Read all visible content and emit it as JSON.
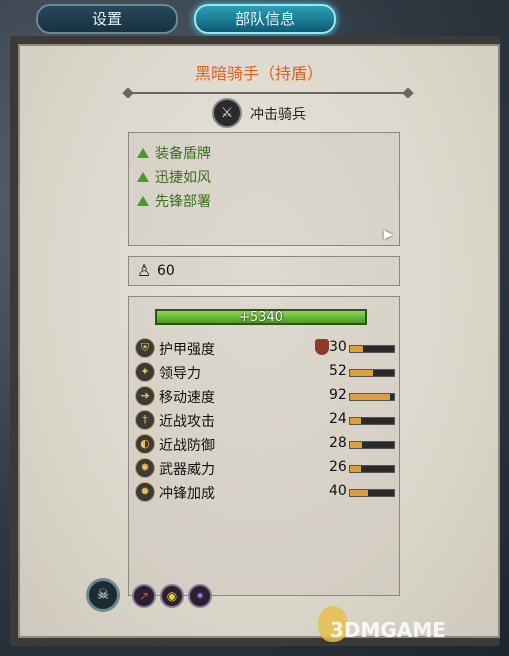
{
  "tabs": {
    "settings_label": "设置",
    "unit_info_label": "部队信息"
  },
  "unit": {
    "title": "黑暗骑手（持盾）",
    "class_label": "冲击骑兵",
    "abilities": [
      {
        "label": "装备盾牌"
      },
      {
        "label": "迅捷如风"
      },
      {
        "label": "先锋部署"
      }
    ],
    "men_count": "60",
    "hp_text": "5340",
    "stats": [
      {
        "label": "护甲强度",
        "value": "30",
        "fill": 0.3
      },
      {
        "label": "领导力",
        "value": "52",
        "fill": 0.52
      },
      {
        "label": "移动速度",
        "value": "92",
        "fill": 0.92
      },
      {
        "label": "近战攻击",
        "value": "24",
        "fill": 0.24
      },
      {
        "label": "近战防御",
        "value": "28",
        "fill": 0.28
      },
      {
        "label": "武器威力",
        "value": "26",
        "fill": 0.26
      },
      {
        "label": "冲锋加成",
        "value": "40",
        "fill": 0.4
      }
    ]
  },
  "watermark": "3DMGAME"
}
